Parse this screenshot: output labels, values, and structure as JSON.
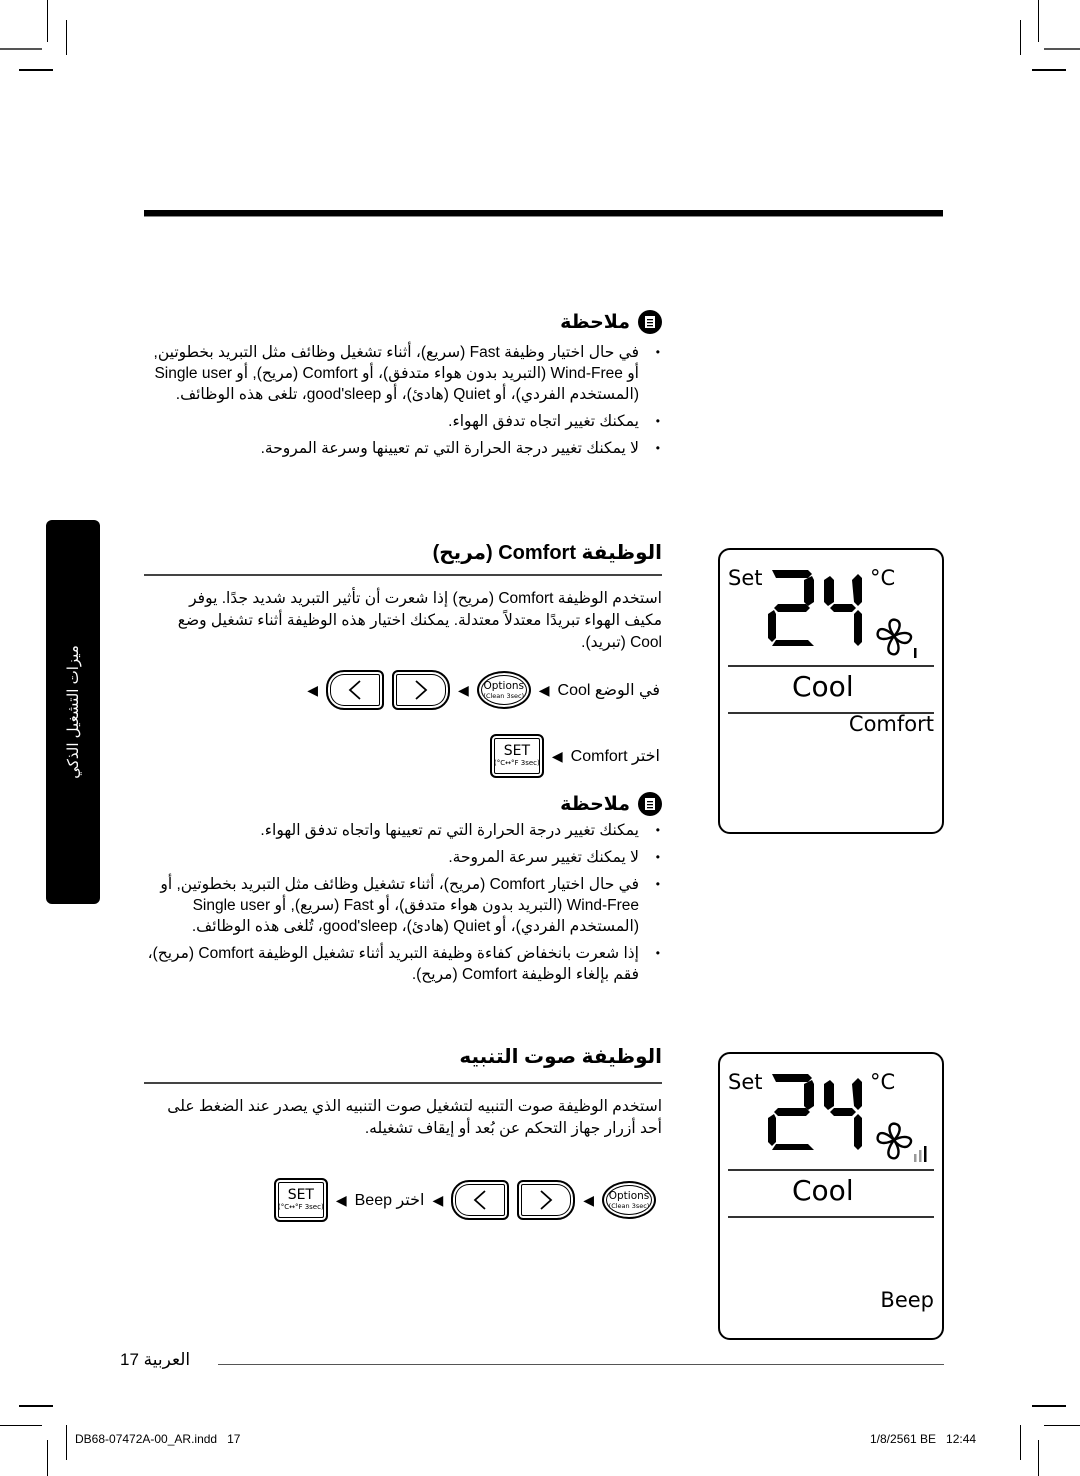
{
  "note_1": {
    "title": "ملاحظة",
    "icon": "note-document-icon",
    "bullets": [
      "في حال اختيار وظيفة Fast (سريع)، أثناء تشغيل وظائف مثل التبريد بخطوتين, أو Wind-Free (التبريد بدون هواء متدفق)، أو Comfort (مريح), أو Single user (المستخدم الفردي)، أو Quiet (هادئ)، أو good'sleep، تلغى هذه الوظائف.",
      "يمكنك تغيير اتجاه تدفق الهواء.",
      "لا يمكنك تغيير درجة الحرارة التي تم تعيينها وسرعة المروحة."
    ]
  },
  "side_tab": {
    "label": "ميزات التشغيل الذكي"
  },
  "comfort_section": {
    "title": "الوظيفة Comfort (مريح)",
    "description": "استخدم الوظيفة Comfort (مريح) إذا شعرت أن تأثير التبريد شديد جدًا. يوفر مكيف الهواء تبريدًا معتدلاً معتدلة. يمكنك اختيار هذه الوظيفة أثناء تشغيل وضع Cool (تبريد).",
    "steps": {
      "row1_prefix": "في الوضع Cool",
      "row2_prefix": "اختر Comfort"
    },
    "note": {
      "title": "ملاحظة",
      "bullets": [
        "يمكنك تغيير درجة الحرارة التي تم تعيينها واتجاه تدفق الهواء.",
        "لا يمكنك تغيير سرعة المروحة.",
        "في حال اختيار Comfort (مريح)، أثناء تشغيل وظائف مثل التبريد بخطوتين, أو Wind-Free (التبريد بدون هواء متدفق)، أو Fast (سريع), أو Single user (المستخدم الفردي)، أو Quiet (هادئ)، good'sleep، تُلغى هذه الوظائف.",
        "إذا شعرت بانخفاض كفاءة وظيفة التبريد أثناء تشغيل الوظيفة Comfort (مريح)، فقم بإلغاء الوظيفة Comfort (مريح)."
      ]
    },
    "display": {
      "set_label": "Set",
      "temperature": "24",
      "unit": "°C",
      "mode": "Cool",
      "function": "Comfort",
      "fan_level_bars": 1
    }
  },
  "beep_section": {
    "title": "الوظيفة صوت التنبيه",
    "description": "استخدم الوظيفة صوت التنبيه لتشغيل صوت التنبيه الذي يصدر عند الضغط على أحد أزرار جهاز التحكم عن بُعد أو إيقاف تشغيله.",
    "steps": {
      "select_label": "اختر Beep"
    },
    "display": {
      "set_label": "Set",
      "temperature": "24",
      "unit": "°C",
      "mode": "Cool",
      "function": "Beep",
      "fan_level_bars": 3
    }
  },
  "buttons": {
    "options_line1": "Options",
    "options_line2": "(Clean 3sec)",
    "set_line1": "SET",
    "set_line2": "(°C↔°F 3sec)",
    "left_arrow": "<",
    "right_arrow": ">",
    "step_arrow": "◀"
  },
  "footer": {
    "page_label": "العربية 17",
    "slug_file": "DB68-07472A-00_AR.indd   17",
    "slug_date": "1/8/2561 BE   12:44"
  }
}
